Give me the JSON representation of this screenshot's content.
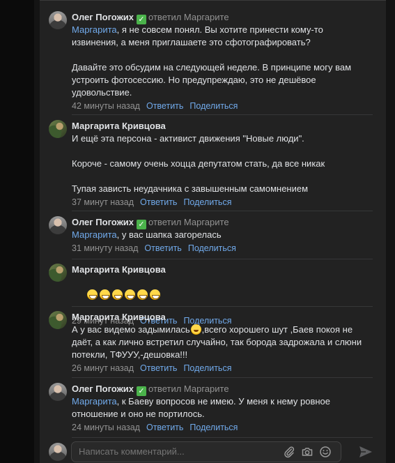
{
  "comments": [
    {
      "author": "Олег Погожих",
      "verified": true,
      "replied": "ответил Маргарите",
      "mention": "Маргарита",
      "text": ", я не совсем понял. Вы хотите принести кому-то\nизвинения, а меня приглашаете это сфотографировать?\n\nДавайте это обсудим на следующей неделе. В принципе могу вам\nустроить фотосессию. Но предупреждаю, это не дешёвое\nудовольствие.",
      "time": "42 минуты назад",
      "reply_label": "Ответить",
      "share_label": "Поделиться"
    },
    {
      "author": "Маргарита Кривцова",
      "text": "И ещё эта персона - активист движения \"Новые люди\".\n\nКороче - самому очень хоцца депутатом стать, да все никак\n\nТупая зависть неудачника с завышенным самомнением",
      "time": "37 минут назад",
      "reply_label": "Ответить",
      "share_label": "Поделиться"
    },
    {
      "author": "Олег Погожих",
      "verified": true,
      "replied": "ответил Маргарите",
      "mention": "Маргарита",
      "text": ", у вас шапка загорелась",
      "time": "31 минуту назад",
      "reply_label": "Ответить",
      "share_label": "Поделиться"
    },
    {
      "author": "Маргарита Кривцова",
      "emoji_count": 6,
      "emoji_name": "grinning-sweat-emoji",
      "time": "29 минут назад",
      "reply_label": "Ответить",
      "share_label": "Поделиться"
    },
    {
      "author": "Маргарита Кривцова",
      "text_before": "А у вас видемо задымилась",
      "inline_emoji": "rofl-emoji",
      "text_after": ",всего хорошего шут ,Баев покоя не\nдаёт, а как лично встретил случайно, так борода задрожала и слюни\nпотекли, ТФУУУ,-дешовка!!!",
      "time": "26 минут назад",
      "reply_label": "Ответить",
      "share_label": "Поделиться"
    },
    {
      "author": "Олег Погожих",
      "verified": true,
      "replied": "ответил Маргарите",
      "mention": "Маргарита",
      "text": ", к Баеву вопросов не имею. У меня к нему ровное\nотношение и оно не портилось.",
      "time": "24 минуты назад",
      "reply_label": "Ответить",
      "share_label": "Поделиться"
    }
  ],
  "composer": {
    "placeholder": "Написать комментарий..."
  },
  "icons": {
    "verified": "check-badge-icon",
    "attach": "paperclip-icon",
    "camera": "camera-icon",
    "emoji": "smile-icon",
    "send": "send-icon"
  },
  "colors": {
    "panel_bg": "#222222",
    "link": "#71aaeb",
    "muted": "#939393",
    "text": "#e1e3e6",
    "verified": "#4bb34b"
  }
}
